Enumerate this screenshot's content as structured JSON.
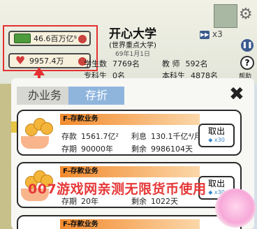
{
  "stats": {
    "money": "46.6百万亿⁹",
    "love": "9957.4万"
  },
  "school": {
    "name": "开心大学",
    "rank": "(世界重点大学)",
    "date": "69年1月1日"
  },
  "counts": {
    "students_label": "学生数",
    "students_value": "7769名",
    "teachers_label": "教 师",
    "teachers_value": "592名",
    "college_label": "专科生",
    "college_value": "0名",
    "undergrad_label": "本科生",
    "undergrad_value": "4878名"
  },
  "controls": {
    "speed": "x3",
    "help_label": "帮助"
  },
  "modal": {
    "tabs": [
      "办业务",
      "存折"
    ],
    "active_tab": "存折"
  },
  "deposits": [
    {
      "title": "F-存款业务",
      "deposit_label": "存款",
      "deposit_value": "1561.7亿²",
      "interest_label": "利息",
      "interest_value": "130.1千亿⁴/月",
      "term_label": "存期",
      "term_value": "90000年",
      "remaining_label": "剩余",
      "remaining_value": "9986104天",
      "button_label": "取出",
      "button_cost": "x30"
    },
    {
      "title": "F-存款业务",
      "deposit_label": "存款",
      "deposit_value": "",
      "interest_label": "利息",
      "interest_value": "",
      "term_label": "存期",
      "term_value": "20年",
      "remaining_label": "剩余",
      "remaining_value": "1022天",
      "button_label": "取出",
      "button_cost": "x30"
    },
    {
      "title": "F-存款业务"
    }
  ],
  "watermark": "007游戏网亲测无限货币使用",
  "colors": {
    "accent_red": "#e53030",
    "tab_active": "#8fb5dd",
    "header_orange": "#f28a2d"
  }
}
